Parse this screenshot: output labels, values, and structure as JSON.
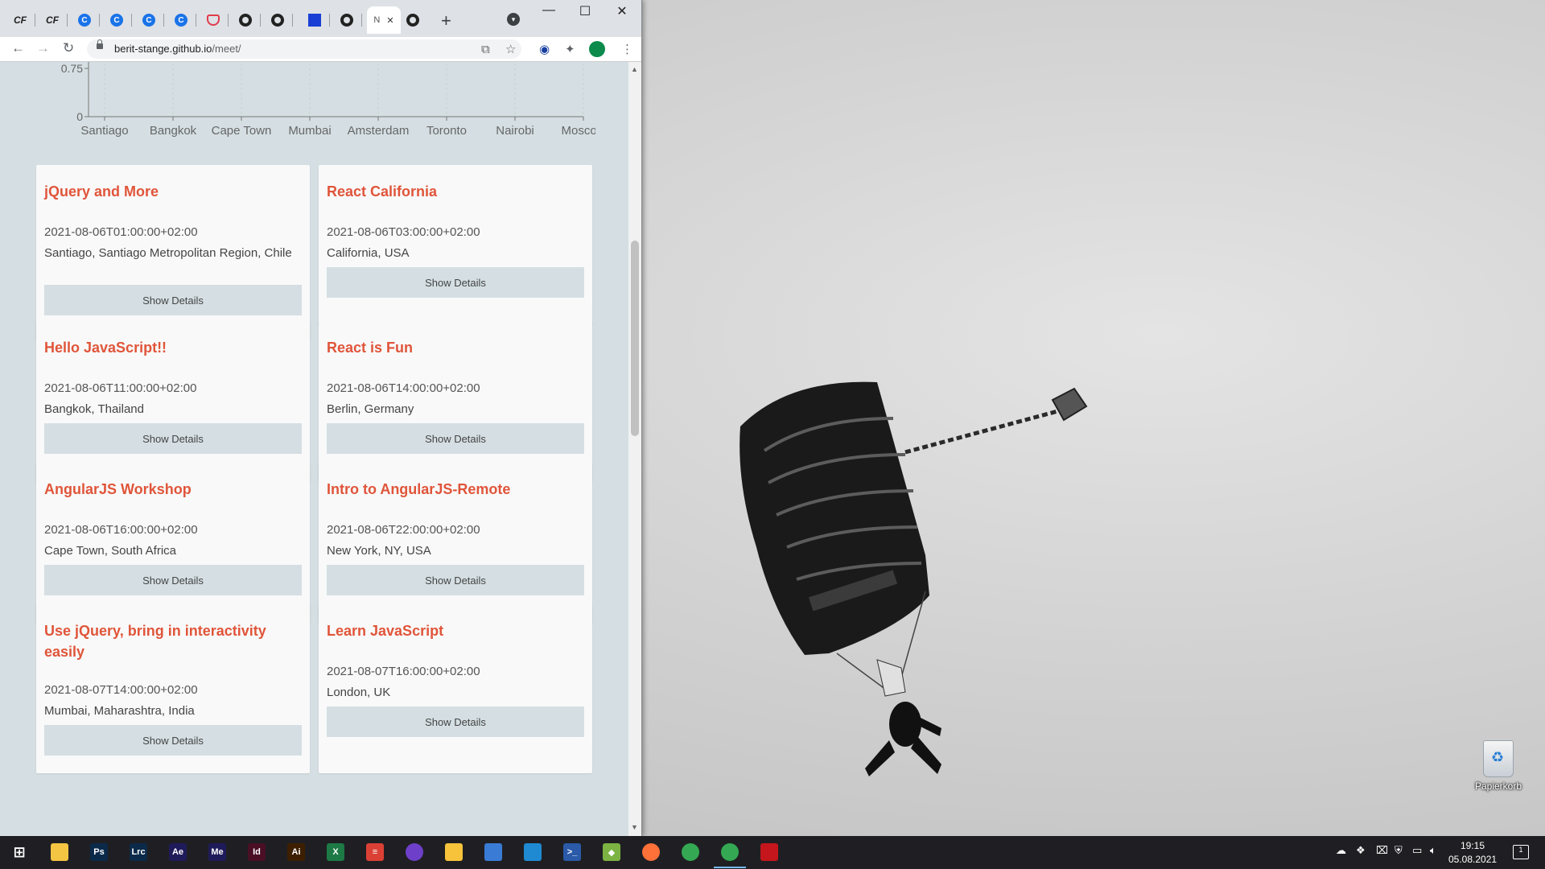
{
  "browser": {
    "tabs": [
      {
        "icon": "cf-icon",
        "text": "CF"
      },
      {
        "icon": "cf-icon",
        "text": "CF"
      },
      {
        "icon": "c-icon",
        "text": "C"
      },
      {
        "icon": "c-icon",
        "text": "C"
      },
      {
        "icon": "c-icon",
        "text": "C"
      },
      {
        "icon": "c-icon",
        "text": "C"
      },
      {
        "icon": "pocket-icon",
        "text": ""
      },
      {
        "icon": "github-icon",
        "text": ""
      },
      {
        "icon": "github-icon",
        "text": ""
      },
      {
        "icon": "blue-square-icon",
        "text": ""
      },
      {
        "icon": "github-icon",
        "text": ""
      },
      {
        "icon": "active-tab",
        "text": "N"
      },
      {
        "icon": "github-icon",
        "text": ""
      }
    ],
    "active_tab_letter": "N",
    "close_glyph": "✕",
    "new_tab": "+",
    "window_controls": {
      "minimize": "—",
      "maximize": "☐",
      "close": "✕"
    },
    "url_host": "berit-stange.github.io",
    "url_path": "/meet/"
  },
  "chart_data": {
    "type": "scatter",
    "categories": [
      "Santiago",
      "Bangkok",
      "Cape Town",
      "Mumbai",
      "Amsterdam",
      "Toronto",
      "Nairobi",
      "Moscow"
    ],
    "y_ticks_visible": [
      "0.75",
      "0"
    ],
    "ylim": [
      0,
      1
    ]
  },
  "events": [
    {
      "title": "jQuery and More",
      "datetime": "2021-08-06T01:00:00+02:00",
      "location": "Santiago, Santiago Metropolitan Region, Chile",
      "button": "Show Details"
    },
    {
      "title": "React California",
      "datetime": "2021-08-06T03:00:00+02:00",
      "location": "California, USA",
      "button": "Show Details"
    },
    {
      "title": "Hello JavaScript!!",
      "datetime": "2021-08-06T11:00:00+02:00",
      "location": "Bangkok, Thailand",
      "button": "Show Details"
    },
    {
      "title": "React is Fun",
      "datetime": "2021-08-06T14:00:00+02:00",
      "location": "Berlin, Germany",
      "button": "Show Details"
    },
    {
      "title": "AngularJS Workshop",
      "datetime": "2021-08-06T16:00:00+02:00",
      "location": "Cape Town, South Africa",
      "button": "Show Details"
    },
    {
      "title": "Intro to AngularJS-Remote",
      "datetime": "2021-08-06T22:00:00+02:00",
      "location": "New York, NY, USA",
      "button": "Show Details"
    },
    {
      "title": "Use jQuery, bring in interactivity easily",
      "datetime": "2021-08-07T14:00:00+02:00",
      "location": "Mumbai, Maharashtra, India",
      "button": "Show Details"
    },
    {
      "title": "Learn JavaScript",
      "datetime": "2021-08-07T16:00:00+02:00",
      "location": "London, UK",
      "button": "Show Details"
    }
  ],
  "desktop": {
    "recycle_bin_label": "Papierkorb"
  },
  "taskbar": {
    "apps": [
      {
        "name": "file-explorer-icon",
        "label": "",
        "color": "#f4c542"
      },
      {
        "name": "photoshop-icon",
        "label": "Ps",
        "color": "#0b2a4a"
      },
      {
        "name": "lightroom-classic-icon",
        "label": "Lrc",
        "color": "#0b2a4a"
      },
      {
        "name": "after-effects-icon",
        "label": "Ae",
        "color": "#1f1b5a"
      },
      {
        "name": "media-encoder-icon",
        "label": "Me",
        "color": "#1f1b5a"
      },
      {
        "name": "indesign-icon",
        "label": "Id",
        "color": "#4a0f25"
      },
      {
        "name": "illustrator-icon",
        "label": "Ai",
        "color": "#3d1f00"
      },
      {
        "name": "excel-icon",
        "label": "X",
        "color": "#1d7a45"
      },
      {
        "name": "todoist-icon",
        "label": "≡",
        "color": "#db4035"
      },
      {
        "name": "github-desktop-icon",
        "label": "",
        "color": "#6e40c9"
      },
      {
        "name": "sublime-icon",
        "label": "",
        "color": "#f7c33a"
      },
      {
        "name": "notion-icon",
        "label": "",
        "color": "#3a7bd5"
      },
      {
        "name": "vscode-icon",
        "label": "",
        "color": "#1f8ad2"
      },
      {
        "name": "powershell-icon",
        "label": ">_",
        "color": "#2a5aa8"
      },
      {
        "name": "git-icon",
        "label": "◆",
        "color": "#7cb342"
      },
      {
        "name": "firefox-icon",
        "label": "",
        "color": "#ff7139"
      },
      {
        "name": "chrome-icon",
        "label": "",
        "color": "#34a853"
      },
      {
        "name": "chrome-active-icon",
        "label": "",
        "color": "#34a853"
      },
      {
        "name": "acrobat-icon",
        "label": "",
        "color": "#c4161c"
      }
    ],
    "time": "19:15",
    "date": "05.08.2021",
    "notification_count": "1"
  }
}
